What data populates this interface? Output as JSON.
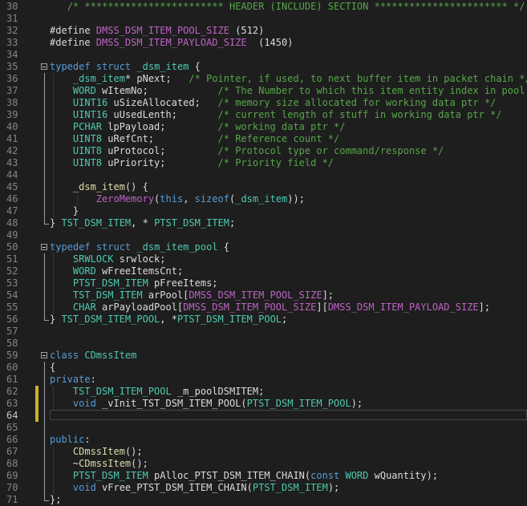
{
  "editor": {
    "lines": [
      {
        "n": "30",
        "tokens": [
          {
            "s": "   ",
            "c": "tx"
          },
          {
            "s": "/* ************************ HEADER (INCLUDE) SECTION *********************** */",
            "c": "c"
          }
        ]
      },
      {
        "n": "31",
        "tokens": []
      },
      {
        "n": "32",
        "tokens": [
          {
            "s": "#define ",
            "c": "tx"
          },
          {
            "s": "DMSS_DSM_ITEM_POOL_SIZE",
            "c": "m"
          },
          {
            "s": " (512)",
            "c": "tx"
          }
        ]
      },
      {
        "n": "33",
        "tokens": [
          {
            "s": "#define ",
            "c": "tx"
          },
          {
            "s": "DMSS_DSM_ITEM_PAYLOAD_SIZE",
            "c": "m"
          },
          {
            "s": "  (1450)",
            "c": "tx"
          }
        ]
      },
      {
        "n": "34",
        "tokens": []
      },
      {
        "n": "35",
        "fold": "start",
        "tokens": [
          {
            "s": "typedef",
            "c": "k"
          },
          {
            "s": " ",
            "c": "tx"
          },
          {
            "s": "struct",
            "c": "k"
          },
          {
            "s": " ",
            "c": "tx"
          },
          {
            "s": "_dsm_item",
            "c": "t"
          },
          {
            "s": " {",
            "c": "tx"
          }
        ]
      },
      {
        "n": "36",
        "guide": 1,
        "tokens": [
          {
            "s": "    ",
            "c": "tx"
          },
          {
            "s": "_dsm_item",
            "c": "t"
          },
          {
            "s": "* pNext;   ",
            "c": "tx"
          },
          {
            "s": "/* Pointer, if used, to next buffer item in packet chain */",
            "c": "c"
          }
        ]
      },
      {
        "n": "37",
        "guide": 1,
        "tokens": [
          {
            "s": "    ",
            "c": "tx"
          },
          {
            "s": "WORD",
            "c": "t"
          },
          {
            "s": " wItemNo;            ",
            "c": "tx"
          },
          {
            "s": "/* The Number to which this item entity index in pool */",
            "c": "c"
          }
        ]
      },
      {
        "n": "38",
        "guide": 1,
        "tokens": [
          {
            "s": "    ",
            "c": "tx"
          },
          {
            "s": "UINT16",
            "c": "t"
          },
          {
            "s": " uSizeAllocated;   ",
            "c": "tx"
          },
          {
            "s": "/* memory size allocated for working data ptr */",
            "c": "c"
          }
        ]
      },
      {
        "n": "39",
        "guide": 1,
        "tokens": [
          {
            "s": "    ",
            "c": "tx"
          },
          {
            "s": "UINT16",
            "c": "t"
          },
          {
            "s": " uUsedLenth;       ",
            "c": "tx"
          },
          {
            "s": "/* current length of stuff in working data ptr */",
            "c": "c"
          }
        ]
      },
      {
        "n": "40",
        "guide": 1,
        "tokens": [
          {
            "s": "    ",
            "c": "tx"
          },
          {
            "s": "PCHAR",
            "c": "t"
          },
          {
            "s": " lpPayload;         ",
            "c": "tx"
          },
          {
            "s": "/* working data ptr */",
            "c": "c"
          }
        ]
      },
      {
        "n": "41",
        "guide": 1,
        "tokens": [
          {
            "s": "    ",
            "c": "tx"
          },
          {
            "s": "UINT8",
            "c": "t"
          },
          {
            "s": " uRefCnt;           ",
            "c": "tx"
          },
          {
            "s": "/* Reference count */",
            "c": "c"
          }
        ]
      },
      {
        "n": "42",
        "guide": 1,
        "tokens": [
          {
            "s": "    ",
            "c": "tx"
          },
          {
            "s": "UINT8",
            "c": "t"
          },
          {
            "s": " uProtocol;         ",
            "c": "tx"
          },
          {
            "s": "/* Protocol type or command/response */",
            "c": "c"
          }
        ]
      },
      {
        "n": "43",
        "guide": 1,
        "tokens": [
          {
            "s": "    ",
            "c": "tx"
          },
          {
            "s": "UINT8",
            "c": "t"
          },
          {
            "s": " uPriority;         ",
            "c": "tx"
          },
          {
            "s": "/* Priority field */",
            "c": "c"
          }
        ]
      },
      {
        "n": "44",
        "guide": 1,
        "tokens": []
      },
      {
        "n": "45",
        "guide": 1,
        "tokens": [
          {
            "s": "    ",
            "c": "tx"
          },
          {
            "s": "_dsm_item",
            "c": "f"
          },
          {
            "s": "() {",
            "c": "tx"
          }
        ]
      },
      {
        "n": "46",
        "guide": 2,
        "tokens": [
          {
            "s": "        ",
            "c": "tx"
          },
          {
            "s": "ZeroMemory",
            "c": "m"
          },
          {
            "s": "(",
            "c": "tx"
          },
          {
            "s": "this",
            "c": "k"
          },
          {
            "s": ", ",
            "c": "tx"
          },
          {
            "s": "sizeof",
            "c": "k"
          },
          {
            "s": "(",
            "c": "tx"
          },
          {
            "s": "_dsm_item",
            "c": "t"
          },
          {
            "s": "));",
            "c": "tx"
          }
        ]
      },
      {
        "n": "47",
        "guide": 1,
        "tokens": [
          {
            "s": "    }",
            "c": "tx"
          }
        ]
      },
      {
        "n": "48",
        "fold": "end",
        "tokens": [
          {
            "s": "} ",
            "c": "tx"
          },
          {
            "s": "TST_DSM_ITEM",
            "c": "t"
          },
          {
            "s": ", * ",
            "c": "tx"
          },
          {
            "s": "PTST_DSM_ITEM",
            "c": "t"
          },
          {
            "s": ";",
            "c": "tx"
          }
        ]
      },
      {
        "n": "49",
        "tokens": []
      },
      {
        "n": "50",
        "fold": "start",
        "tokens": [
          {
            "s": "typedef",
            "c": "k"
          },
          {
            "s": " ",
            "c": "tx"
          },
          {
            "s": "struct",
            "c": "k"
          },
          {
            "s": " ",
            "c": "tx"
          },
          {
            "s": "_dsm_item_pool",
            "c": "t"
          },
          {
            "s": " {",
            "c": "tx"
          }
        ]
      },
      {
        "n": "51",
        "guide": 1,
        "tokens": [
          {
            "s": "    ",
            "c": "tx"
          },
          {
            "s": "SRWLOCK",
            "c": "t"
          },
          {
            "s": " srwlock;",
            "c": "tx"
          }
        ]
      },
      {
        "n": "52",
        "guide": 1,
        "tokens": [
          {
            "s": "    ",
            "c": "tx"
          },
          {
            "s": "WORD",
            "c": "t"
          },
          {
            "s": " wFreeItemsCnt;",
            "c": "tx"
          }
        ]
      },
      {
        "n": "53",
        "guide": 1,
        "tokens": [
          {
            "s": "    ",
            "c": "tx"
          },
          {
            "s": "PTST_DSM_ITEM",
            "c": "t"
          },
          {
            "s": " pFreeItems;",
            "c": "tx"
          }
        ]
      },
      {
        "n": "54",
        "guide": 1,
        "tokens": [
          {
            "s": "    ",
            "c": "tx"
          },
          {
            "s": "TST_DSM_ITEM",
            "c": "t"
          },
          {
            "s": " arPool[",
            "c": "tx"
          },
          {
            "s": "DMSS_DSM_ITEM_POOL_SIZE",
            "c": "m"
          },
          {
            "s": "];",
            "c": "tx"
          }
        ]
      },
      {
        "n": "55",
        "guide": 1,
        "tokens": [
          {
            "s": "    ",
            "c": "tx"
          },
          {
            "s": "CHAR",
            "c": "t"
          },
          {
            "s": " arPayloadPool[",
            "c": "tx"
          },
          {
            "s": "DMSS_DSM_ITEM_POOL_SIZE",
            "c": "m"
          },
          {
            "s": "][",
            "c": "tx"
          },
          {
            "s": "DMSS_DSM_ITEM_PAYLOAD_SIZE",
            "c": "m"
          },
          {
            "s": "];",
            "c": "tx"
          }
        ]
      },
      {
        "n": "56",
        "fold": "end",
        "tokens": [
          {
            "s": "} ",
            "c": "tx"
          },
          {
            "s": "TST_DSM_ITEM_POOL",
            "c": "t"
          },
          {
            "s": ", *",
            "c": "tx"
          },
          {
            "s": "PTST_DSM_ITEM_POOL",
            "c": "t"
          },
          {
            "s": ";",
            "c": "tx"
          }
        ]
      },
      {
        "n": "57",
        "tokens": []
      },
      {
        "n": "58",
        "tokens": []
      },
      {
        "n": "59",
        "fold": "start",
        "tokens": [
          {
            "s": "class",
            "c": "k"
          },
          {
            "s": " ",
            "c": "tx"
          },
          {
            "s": "CDmssItem",
            "c": "t"
          }
        ]
      },
      {
        "n": "60",
        "fold": "mid",
        "tokens": [
          {
            "s": "{",
            "c": "tx"
          }
        ]
      },
      {
        "n": "61",
        "fold": "mid",
        "tokens": [
          {
            "s": "private",
            "c": "k"
          },
          {
            "s": ":",
            "c": "tx"
          }
        ]
      },
      {
        "n": "62",
        "fold": "mid",
        "guide": 1,
        "modified": true,
        "tokens": [
          {
            "s": "    ",
            "c": "tx"
          },
          {
            "s": "TST_DSM_ITEM_POOL",
            "c": "t"
          },
          {
            "s": " _m_poolDSMITEM;",
            "c": "tx"
          }
        ]
      },
      {
        "n": "63",
        "fold": "mid",
        "guide": 1,
        "modified": true,
        "tokens": [
          {
            "s": "    ",
            "c": "tx"
          },
          {
            "s": "void",
            "c": "k"
          },
          {
            "s": " _vInit_TST_DSM_ITEM_POOL(",
            "c": "tx"
          },
          {
            "s": "PTST_DSM_ITEM_POOL",
            "c": "t"
          },
          {
            "s": ");",
            "c": "tx"
          }
        ]
      },
      {
        "n": "64",
        "fold": "mid",
        "active": true,
        "modified": true,
        "tokens": []
      },
      {
        "n": "65",
        "fold": "mid",
        "tokens": []
      },
      {
        "n": "66",
        "fold": "mid",
        "tokens": [
          {
            "s": "public",
            "c": "k"
          },
          {
            "s": ":",
            "c": "tx"
          }
        ]
      },
      {
        "n": "67",
        "fold": "mid",
        "guide": 1,
        "tokens": [
          {
            "s": "    ",
            "c": "tx"
          },
          {
            "s": "CDmssItem",
            "c": "f"
          },
          {
            "s": "();",
            "c": "tx"
          }
        ]
      },
      {
        "n": "68",
        "fold": "mid",
        "guide": 1,
        "tokens": [
          {
            "s": "    ~",
            "c": "tx"
          },
          {
            "s": "CDmssItem",
            "c": "f"
          },
          {
            "s": "();",
            "c": "tx"
          }
        ]
      },
      {
        "n": "69",
        "fold": "mid",
        "guide": 1,
        "tokens": [
          {
            "s": "    ",
            "c": "tx"
          },
          {
            "s": "PTST_DSM_ITEM",
            "c": "t"
          },
          {
            "s": " pAlloc_PTST_DSM_ITEM_CHAIN(",
            "c": "tx"
          },
          {
            "s": "const",
            "c": "k"
          },
          {
            "s": " ",
            "c": "tx"
          },
          {
            "s": "WORD",
            "c": "t"
          },
          {
            "s": " wQuantity);",
            "c": "tx"
          }
        ]
      },
      {
        "n": "70",
        "fold": "mid",
        "guide": 1,
        "tokens": [
          {
            "s": "    ",
            "c": "tx"
          },
          {
            "s": "void",
            "c": "k"
          },
          {
            "s": " vFree_PTST_DSM_ITEM_CHAIN(",
            "c": "tx"
          },
          {
            "s": "PTST_DSM_ITEM",
            "c": "t"
          },
          {
            "s": ");",
            "c": "tx"
          }
        ]
      },
      {
        "n": "71",
        "fold": "end",
        "tokens": [
          {
            "s": "};",
            "c": "tx"
          }
        ]
      }
    ]
  }
}
